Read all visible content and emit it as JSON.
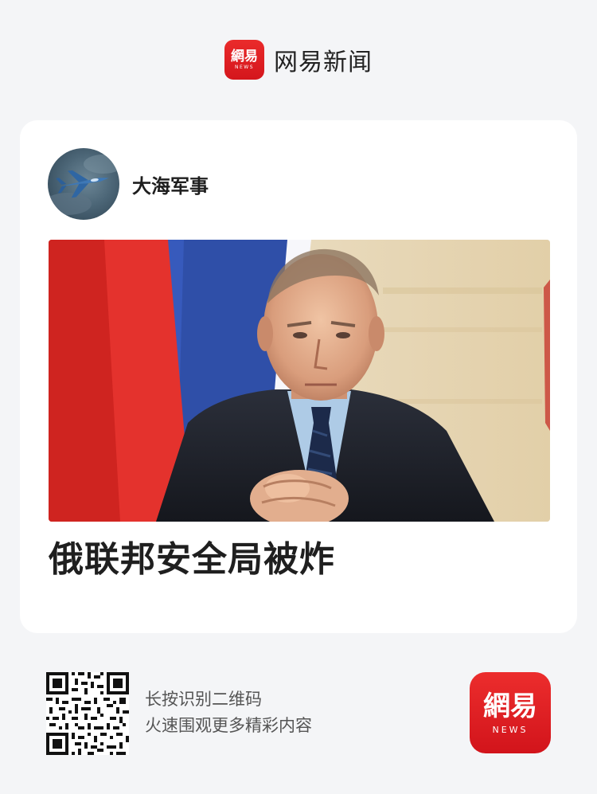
{
  "header": {
    "logo_cn": "網易",
    "logo_en": "NEWS",
    "brand_name": "网易新闻"
  },
  "card": {
    "author": {
      "name": "大海军事",
      "avatar_icon": "fighter-jet-avatar"
    },
    "image_icon": "news-photo",
    "headline": "俄联邦安全局被炸"
  },
  "footer": {
    "qr_icon": "qr-code-icon",
    "line1": "长按识别二维码",
    "line2": "火速围观更多精彩内容",
    "logo_cn": "網易",
    "logo_en": "NEWS"
  },
  "colors": {
    "brand_red": "#e01f24",
    "background": "#f4f5f7",
    "card": "#ffffff"
  }
}
